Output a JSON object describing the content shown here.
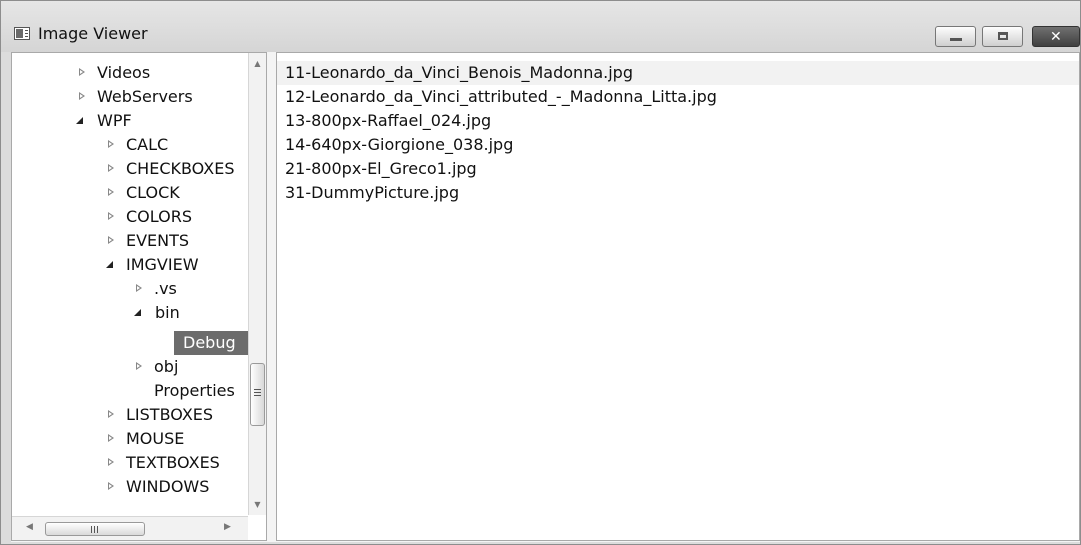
{
  "window": {
    "title": "Image Viewer"
  },
  "tree": {
    "items": [
      {
        "label": "Videos",
        "state": "collapsed"
      },
      {
        "label": "WebServers",
        "state": "collapsed"
      },
      {
        "label": "WPF",
        "state": "expanded"
      },
      {
        "label": "CALC",
        "state": "collapsed"
      },
      {
        "label": "CHECKBOXES",
        "state": "collapsed"
      },
      {
        "label": "CLOCK",
        "state": "collapsed"
      },
      {
        "label": "COLORS",
        "state": "collapsed"
      },
      {
        "label": "EVENTS",
        "state": "collapsed"
      },
      {
        "label": "IMGVIEW",
        "state": "expanded"
      },
      {
        "label": ".vs",
        "state": "collapsed"
      },
      {
        "label": "bin",
        "state": "expanded"
      },
      {
        "label": "Debug",
        "state": "selected"
      },
      {
        "label": "obj",
        "state": "collapsed"
      },
      {
        "label": "Properties",
        "state": "leaf"
      },
      {
        "label": "LISTBOXES",
        "state": "collapsed"
      },
      {
        "label": "MOUSE",
        "state": "collapsed"
      },
      {
        "label": "TEXTBOXES",
        "state": "collapsed"
      },
      {
        "label": "WINDOWS",
        "state": "collapsed"
      }
    ]
  },
  "files": [
    "11-Leonardo_da_Vinci_Benois_Madonna.jpg",
    "12-Leonardo_da_Vinci_attributed_-_Madonna_Litta.jpg",
    "13-800px-Raffael_024.jpg",
    "14-640px-Giorgione_038.jpg",
    "21-800px-El_Greco1.jpg",
    "31-DummyPicture.jpg"
  ],
  "icons": {
    "window": "image-viewer-icon",
    "minimize": "minimize-icon",
    "maximize": "maximize-icon",
    "close": "close-icon"
  },
  "colors": {
    "selected": "#6c6c6c",
    "hover": "#f2f2f2"
  }
}
